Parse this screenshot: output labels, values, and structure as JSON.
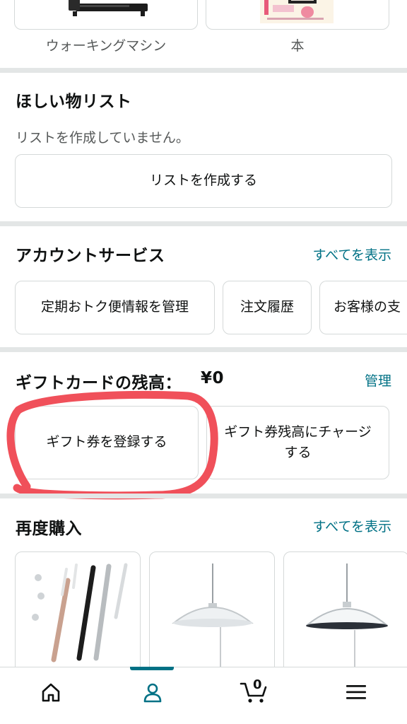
{
  "top_strip": {
    "items": [
      {
        "label": "ウォーキングマシン",
        "icon": "treadmill-image"
      },
      {
        "label": "本",
        "icon": "book-cover-image"
      }
    ]
  },
  "wishlist": {
    "title": "ほしい物リスト",
    "empty_text": "リストを作成していません。",
    "create_button": "リストを作成する"
  },
  "account_services": {
    "title": "アカウントサービス",
    "see_all": "すべてを表示",
    "buttons": [
      "定期おトク便情報を管理",
      "注文履歴",
      "お客様の支"
    ]
  },
  "gift_card": {
    "title": "ギフトカードの残高：",
    "balance": "¥0",
    "manage": "管理",
    "register_button": "ギフト券を登録する",
    "charge_button": "ギフト券残高にチャージする",
    "highlight_color": "#f0505a"
  },
  "buy_again": {
    "title": "再度購入",
    "see_all": "すべてを表示",
    "products": [
      {
        "icon": "stylus-pens-image"
      },
      {
        "icon": "pendant-lamp-image"
      },
      {
        "icon": "pendant-lamp-image"
      }
    ]
  },
  "bottom_nav": {
    "items": [
      "home-icon",
      "account-icon",
      "cart-icon",
      "menu-icon"
    ],
    "cart_count": "0",
    "active": "account-icon",
    "accent": "#007185"
  }
}
